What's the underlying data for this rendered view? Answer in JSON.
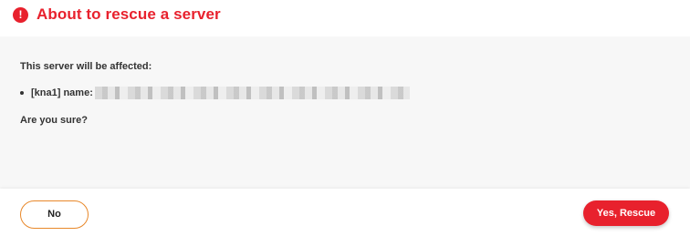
{
  "dialog": {
    "title": "About to rescue a server",
    "title_icon": "alert-circle-icon",
    "accent_color": "#e8212d",
    "message_intro": "This server will be affected:",
    "servers": [
      {
        "label": "[kna1] name:"
      }
    ],
    "question": "Are you sure?"
  },
  "footer": {
    "cancel_label": "No",
    "cancel_border_color": "#e8882a",
    "confirm_label": "Yes, Rescue"
  }
}
